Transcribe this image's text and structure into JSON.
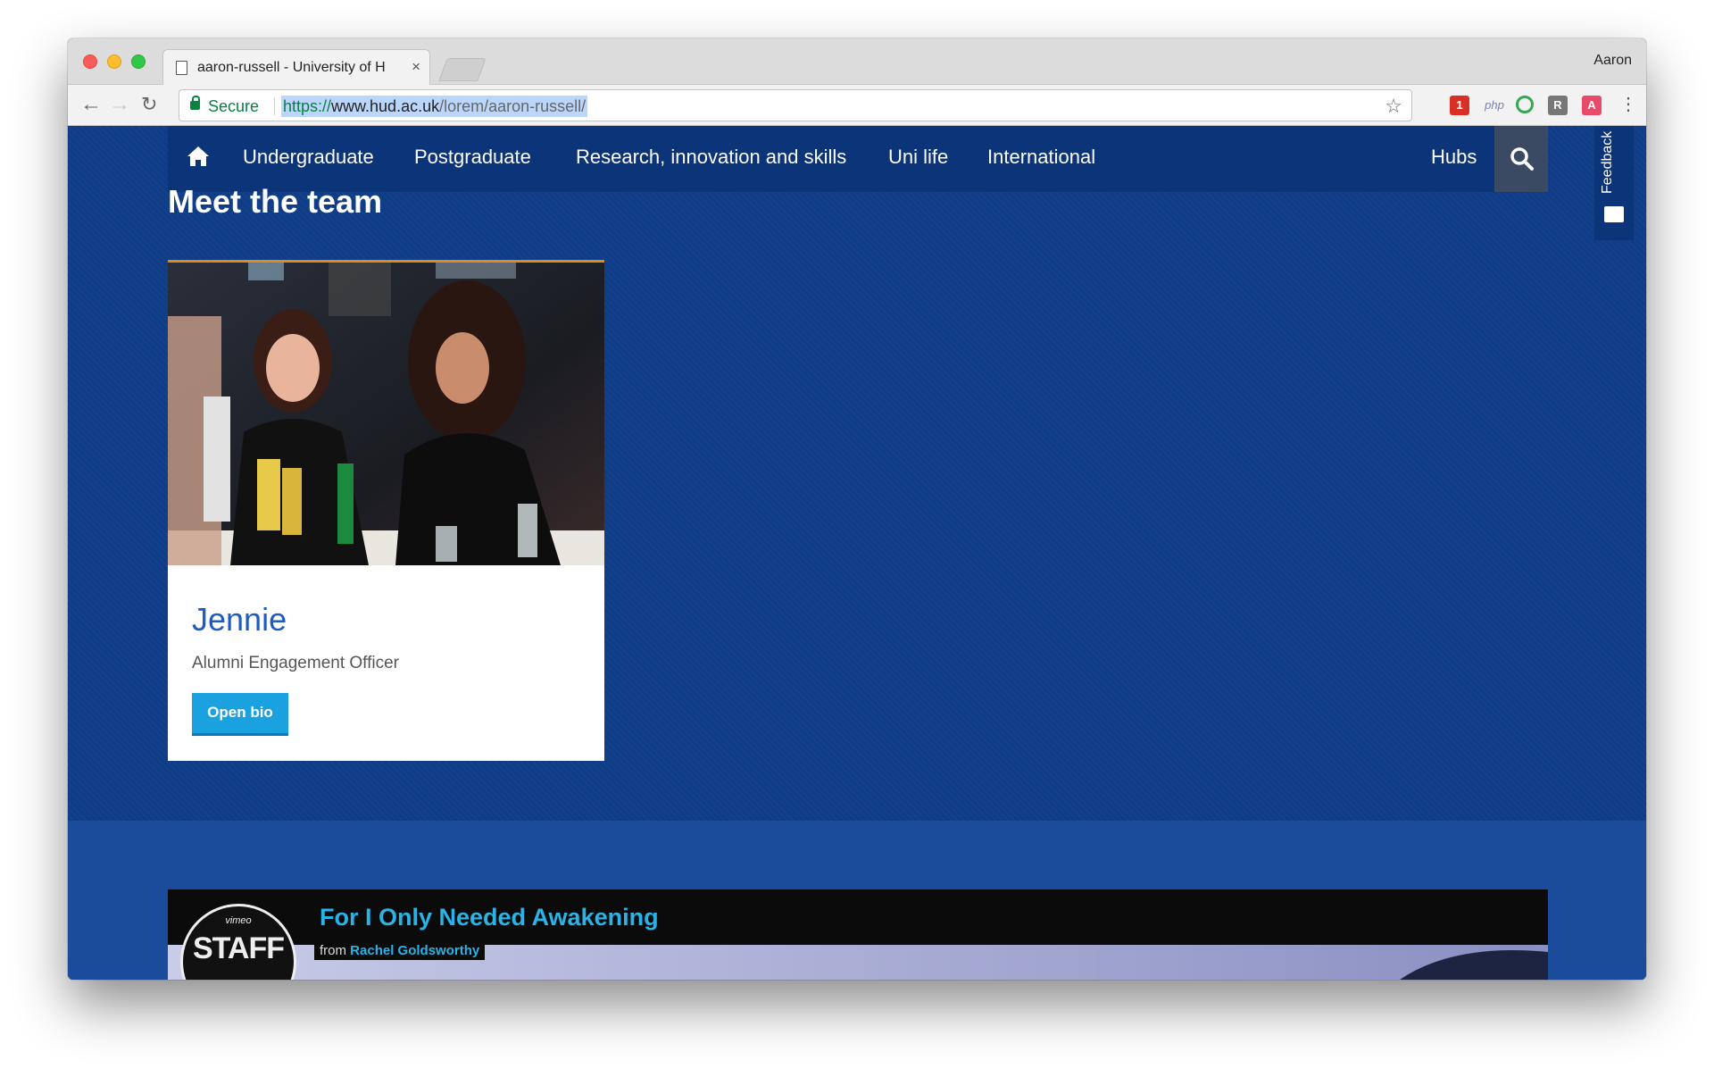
{
  "browser": {
    "tab_title": "aaron-russell - University of H",
    "tab_close": "×",
    "profile_name": "Aaron",
    "secure_label": "Secure",
    "url_scheme": "https://",
    "url_host": "www.hud.ac.uk",
    "url_path": "/lorem/aaron-russell/",
    "icons": [
      "back-arrow-icon",
      "forward-arrow-icon",
      "reload-icon",
      "lock-icon",
      "star-icon",
      "menu-dots-icon"
    ],
    "extensions": [
      {
        "name": "calendar-extension-icon",
        "label": "1",
        "color": "#d93025"
      },
      {
        "name": "php-extension-icon",
        "label": "php",
        "color": "#7b7fb5"
      },
      {
        "name": "green-ring-extension-icon",
        "label": "",
        "color": "#34a853"
      },
      {
        "name": "r-extension-icon",
        "label": "R",
        "color": "#777777"
      },
      {
        "name": "a-extension-icon",
        "label": "A",
        "color": "#e84a6a"
      }
    ]
  },
  "nav": {
    "items": [
      "Undergraduate",
      "Postgraduate",
      "Research, innovation and skills",
      "Uni life",
      "International"
    ],
    "hubs": "Hubs",
    "icons": [
      "home-icon",
      "search-icon"
    ]
  },
  "feedback": {
    "label": "Feedback",
    "icon": "feedback-icon"
  },
  "section": {
    "title": "Meet the team"
  },
  "card": {
    "name": "Jennie",
    "role": "Alumni Engagement Officer",
    "button": "Open bio"
  },
  "video": {
    "badge_brand": "vimeo",
    "badge_text": "STAFF",
    "title": "For I Only Needed Awakening",
    "from_label": "from",
    "author": "Rachel Goldsworthy"
  },
  "colors": {
    "page_bg": "#0f3c87",
    "nav_bg": "#0c3478",
    "name_blue": "#1f5bc1",
    "button_blue": "#1aa2e0",
    "accent_orange": "#e08a1e",
    "video_link": "#29b3e6"
  }
}
